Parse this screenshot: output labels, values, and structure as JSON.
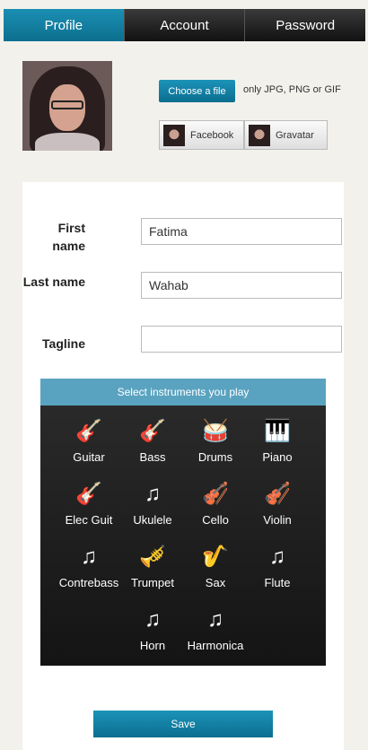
{
  "tabs": [
    {
      "label": "Profile",
      "active": true
    },
    {
      "label": "Account",
      "active": false
    },
    {
      "label": "Password",
      "active": false
    }
  ],
  "upload": {
    "choose_label": "Choose a file",
    "hint": "only JPG, PNG or GIF"
  },
  "social": {
    "facebook_label": "Facebook",
    "gravatar_label": "Gravatar"
  },
  "form": {
    "first_name_label": "First name",
    "first_name_value": "Fatima",
    "last_name_label": "Last name",
    "last_name_value": "Wahab",
    "tagline_label": "Tagline",
    "tagline_value": ""
  },
  "instruments": {
    "header": "Select instruments you play",
    "items": [
      {
        "name": "Guitar",
        "icon": "guitar-icon",
        "glyph": "🎸"
      },
      {
        "name": "Bass",
        "icon": "bass-icon",
        "glyph": "🎸"
      },
      {
        "name": "Drums",
        "icon": "drums-icon",
        "glyph": "🥁"
      },
      {
        "name": "Piano",
        "icon": "piano-icon",
        "glyph": "🎹"
      },
      {
        "name": "Elec Guit",
        "icon": "electric-guitar-icon",
        "glyph": "🎸"
      },
      {
        "name": "Ukulele",
        "icon": "music-note-icon",
        "glyph": "♫"
      },
      {
        "name": "Cello",
        "icon": "cello-icon",
        "glyph": "🎻"
      },
      {
        "name": "Violin",
        "icon": "violin-icon",
        "glyph": "🎻"
      },
      {
        "name": "Contrebass",
        "icon": "music-note-icon",
        "glyph": "♫"
      },
      {
        "name": "Trumpet",
        "icon": "trumpet-icon",
        "glyph": "🎺"
      },
      {
        "name": "Sax",
        "icon": "saxophone-icon",
        "glyph": "🎷"
      },
      {
        "name": "Flute",
        "icon": "music-note-icon",
        "glyph": "♫"
      },
      {
        "name": "Horn",
        "icon": "music-note-icon",
        "glyph": "♫"
      },
      {
        "name": "Harmonica",
        "icon": "music-note-icon",
        "glyph": "♫"
      }
    ]
  },
  "save_label": "Save",
  "colors": {
    "accent": "#0d7fa3",
    "instrument_header": "#5aa3c0",
    "dark_panel": "#1e1e1e"
  }
}
